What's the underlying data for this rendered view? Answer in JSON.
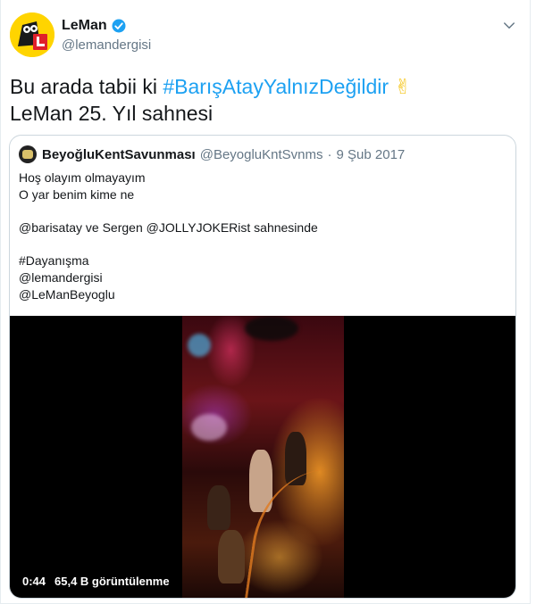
{
  "author": {
    "display_name": "LeMan",
    "handle": "@lemandergisi",
    "verified": true
  },
  "tweet": {
    "text_prefix": "Bu arada tabii ki ",
    "hashtag": "#BarışAtayYalnızDeğildir",
    "emoji": "✌",
    "line2": "LeMan 25. Yıl sahnesi"
  },
  "quote": {
    "display_name": "BeyoğluKentSavunması",
    "handle": "@BeyogluKntSvnms",
    "separator": "·",
    "date": "9 Şub 2017",
    "lines": [
      "Hoş olayım olmayayım",
      "O yar benim kime ne",
      "",
      "@barisatay ve Sergen @JOLLYJOKERist sahnesinde",
      "",
      "#Dayanışma",
      "@lemandergisi",
      "@LeManBeyoglu"
    ]
  },
  "video": {
    "duration": "0:44",
    "views": "65,4 B görüntülenme"
  },
  "colors": {
    "link": "#1da1f2",
    "secondary_text": "#657786",
    "border": "#ccd6dd"
  }
}
